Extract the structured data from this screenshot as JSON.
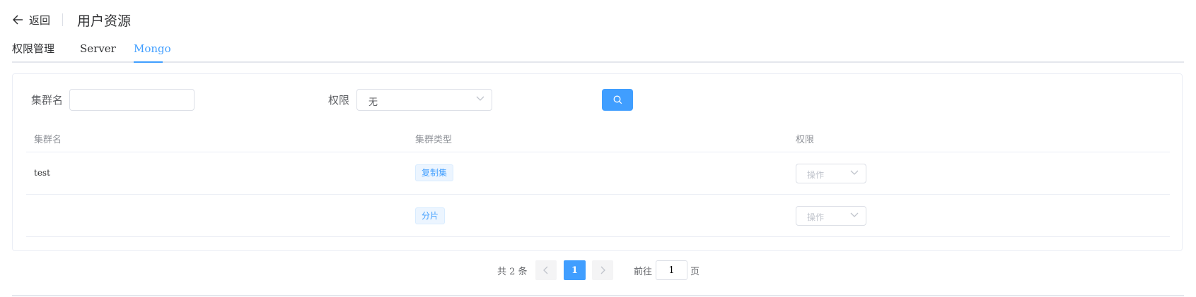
{
  "header": {
    "back_label": "返回",
    "title": "用户资源"
  },
  "tabs": [
    {
      "label": "权限管理",
      "active": false
    },
    {
      "label": "Server",
      "active": false
    },
    {
      "label": "Mongo",
      "active": true
    }
  ],
  "filter": {
    "cluster_label": "集群名",
    "cluster_value": "",
    "cluster_placeholder": "",
    "permission_label": "权限",
    "permission_value": "无",
    "search_icon": "search-icon"
  },
  "table": {
    "columns": [
      "集群名",
      "集群类型",
      "权限"
    ],
    "rows": [
      {
        "name": "test",
        "type": "复制集",
        "action": "操作"
      },
      {
        "name": "",
        "type": "分片",
        "action": "操作"
      }
    ]
  },
  "pagination": {
    "total": "共 2 条",
    "current": "1",
    "goto_label": "前往",
    "goto_value": "1",
    "page_suffix": "页"
  },
  "colors": {
    "accent": "#409eff",
    "text": "#303133",
    "muted": "#909399",
    "border": "#dcdfe6"
  }
}
